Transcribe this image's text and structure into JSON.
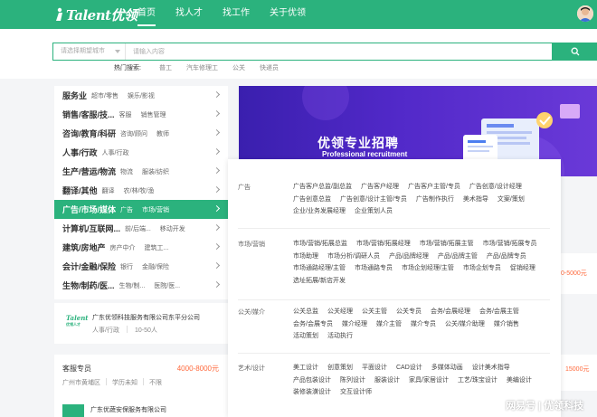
{
  "header": {
    "logo_text": "Talent优领",
    "nav": [
      "首页",
      "找人才",
      "找工作",
      "关于优领"
    ]
  },
  "search": {
    "city_placeholder": "请选择期望城市",
    "input_placeholder": "请输入内容",
    "hot_label": "热门搜索:",
    "hot_items": [
      "普工",
      "汽车修理工",
      "公关",
      "快递员"
    ]
  },
  "categories": [
    {
      "main": "服务业",
      "subs": [
        "超市/零售",
        "娱乐/影视"
      ]
    },
    {
      "main": "销售/客服/技...",
      "subs": [
        "客服",
        "销售管理"
      ]
    },
    {
      "main": "咨询/教育/科研",
      "subs": [
        "咨询/顾问",
        "教师"
      ]
    },
    {
      "main": "人事/行政",
      "subs": [
        "人事/行政"
      ]
    },
    {
      "main": "生产/营运/物流",
      "subs": [
        "物流",
        "服装/纺织"
      ]
    },
    {
      "main": "翻译/其他",
      "subs": [
        "翻译",
        "农/林/牧/渔"
      ]
    },
    {
      "main": "广告/市场/媒体",
      "subs": [
        "广告",
        "市场/营销"
      ]
    },
    {
      "main": "计算机/互联网...",
      "subs": [
        "前/后端...",
        "移动开发"
      ]
    },
    {
      "main": "建筑/房地产",
      "subs": [
        "房产中介",
        "建筑工..."
      ]
    },
    {
      "main": "会计/金融/保险",
      "subs": [
        "银行",
        "金融/保险"
      ]
    },
    {
      "main": "生物/制药/医...",
      "subs": [
        "生物/制...",
        "医院/医..."
      ]
    }
  ],
  "company_card": {
    "logo_text": "Talent",
    "logo_sub": "优领人才",
    "name": "广东优领科技服务有限公司东平分公司",
    "industry": "人事/行政",
    "size": "10-50人"
  },
  "job_card": {
    "title": "客服专员",
    "salary": "4000-8000元",
    "location": "广州市黄埔区",
    "education": "学历未知",
    "experience": "不限",
    "company": "广东优蔬安保服务有限公司"
  },
  "banner": {
    "title": "优领专业招聘",
    "subtitle": "Professional recruitment"
  },
  "right_salaries": [
    "0-5000元",
    "15000元"
  ],
  "dropdown": [
    {
      "category": "广告",
      "links": [
        "广告客户总监/副总监",
        "广告客户经理",
        "广告客户主管/专员",
        "广告创意/设计经理",
        "广告创意总监",
        "广告创意/设计主管/专员",
        "广告制作执行",
        "美术指导",
        "文案/策划",
        "企业/业务发展经理",
        "企业策划人员"
      ]
    },
    {
      "category": "市场/营销",
      "links": [
        "市场/营销/拓展总监",
        "市场/营销/拓展经理",
        "市场/营销/拓展主管",
        "市场/营销/拓展专员",
        "市场助理",
        "市场分析/调研人员",
        "产品/品牌经理",
        "产品/品牌主管",
        "产品/品牌专员",
        "市场通路经理/主管",
        "市场通路专员",
        "市场企划经理/主管",
        "市场企划专员",
        "促销经理",
        "选址拓展/新店开发"
      ]
    },
    {
      "category": "公关/媒介",
      "links": [
        "公关总监",
        "公关经理",
        "公关主管",
        "公关专员",
        "会务/会展经理",
        "会务/会展主管",
        "会务/会展专员",
        "媒介经理",
        "媒介主管",
        "媒介专员",
        "公关/媒介助理",
        "媒介销售",
        "活动策划",
        "活动执行"
      ]
    },
    {
      "category": "艺术/设计",
      "links": [
        "美工设计",
        "创意策划",
        "平面设计",
        "CAD设计",
        "多媒体动画",
        "设计美术指导",
        "产品包装设计",
        "陈列设计",
        "服装设计",
        "家具/家居设计",
        "工艺/珠宝设计",
        "美编设计",
        "装修装潢设计",
        "交互设计师"
      ]
    }
  ],
  "watermark": "网易号 | 优领科技",
  "colors": {
    "brand": "#2bb27d",
    "salary": "#ff6a3d"
  }
}
